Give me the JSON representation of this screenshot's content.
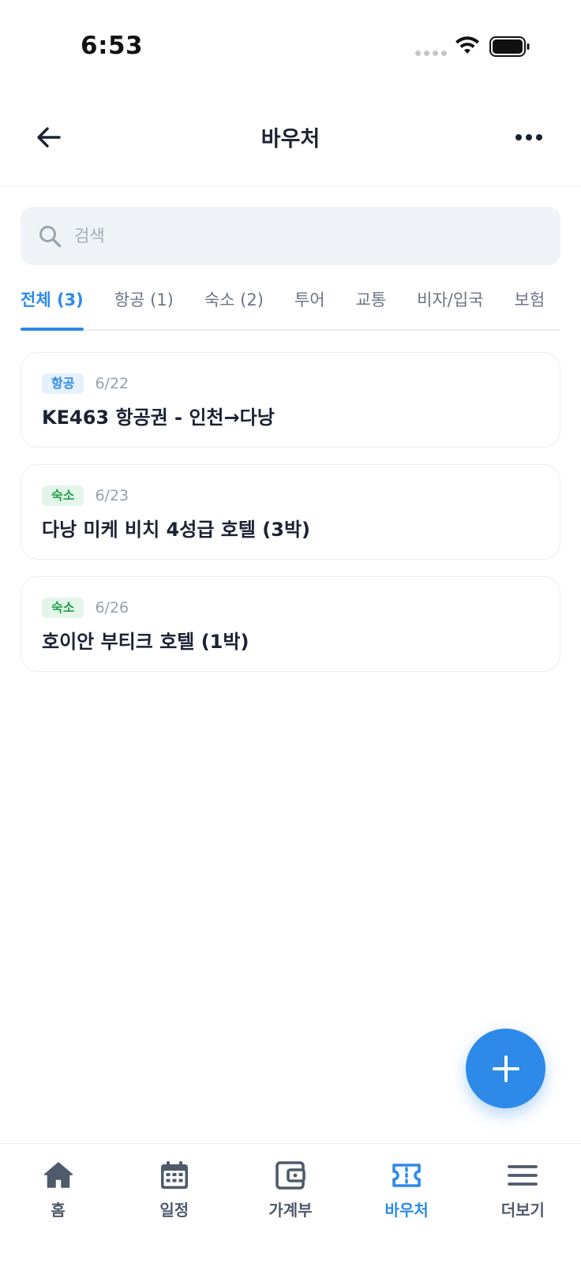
{
  "status_bar": {
    "time": "6:53"
  },
  "header": {
    "title": "바우처"
  },
  "search": {
    "placeholder": "검색"
  },
  "tabs": [
    {
      "label": "전체 (3)",
      "active": true
    },
    {
      "label": "항공 (1)",
      "active": false
    },
    {
      "label": "숙소 (2)",
      "active": false
    },
    {
      "label": "투어",
      "active": false
    },
    {
      "label": "교통",
      "active": false
    },
    {
      "label": "비자/입국",
      "active": false
    },
    {
      "label": "보험",
      "active": false
    }
  ],
  "vouchers": [
    {
      "category": "항공",
      "date": "6/22",
      "title": "KE463 항공권 - 인천→다낭"
    },
    {
      "category": "숙소",
      "date": "6/23",
      "title": "다낭 미케 비치 4성급 호텔 (3박)"
    },
    {
      "category": "숙소",
      "date": "6/26",
      "title": "호이안 부티크 호텔 (1박)"
    }
  ],
  "fab": {
    "icon": "plus-icon"
  },
  "bottom_nav": [
    {
      "label": "홈",
      "icon": "home-icon",
      "active": false
    },
    {
      "label": "일정",
      "icon": "calendar-icon",
      "active": false
    },
    {
      "label": "가계부",
      "icon": "wallet-icon",
      "active": false
    },
    {
      "label": "바우처",
      "icon": "ticket-icon",
      "active": true
    },
    {
      "label": "더보기",
      "icon": "menu-icon",
      "active": false
    }
  ],
  "colors": {
    "accent": "#2d8ae8",
    "flight_badge_bg": "#e6f1fc",
    "stay_badge_bg": "#e4f6ea",
    "stay_badge_text": "#22a04b",
    "nav_inactive": "#4f5a6c"
  }
}
